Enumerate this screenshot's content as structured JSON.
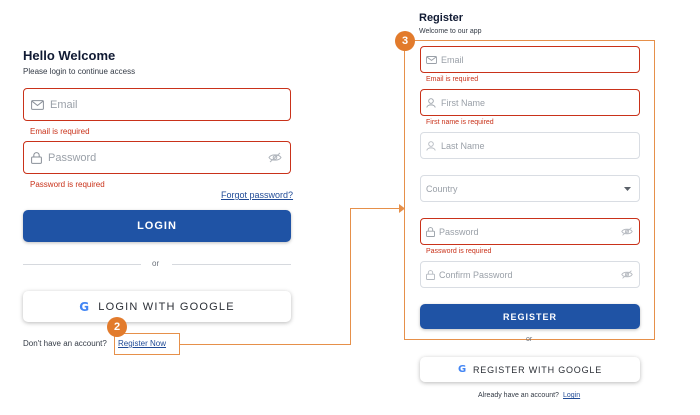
{
  "login": {
    "title": "Hello Welcome",
    "subtitle": "Please login to continue access",
    "email_placeholder": "Email",
    "email_error": "Email is required",
    "password_placeholder": "Password",
    "password_error": "Password is required",
    "forgot_password": "Forgot password?",
    "login_button": "LOGIN",
    "or_text": "or",
    "google_button": "LOGIN WITH GOOGLE",
    "no_account_text": "Don't have an account?",
    "register_link": "Register Now"
  },
  "register": {
    "title": "Register",
    "subtitle": "Welcome to our app",
    "email_placeholder": "Email",
    "email_error": "Email is required",
    "first_name_placeholder": "First Name",
    "first_name_error": "First name is required",
    "last_name_placeholder": "Last Name",
    "country_placeholder": "Country",
    "password_placeholder": "Password",
    "password_error": "Password is required",
    "confirm_password_placeholder": "Confirm Password",
    "register_button": "REGISTER",
    "or_text": "or",
    "google_button": "REGISTER WITH GOOGLE",
    "have_account_text": "Already have an account?",
    "login_link": "Login"
  },
  "annotations": {
    "step_register_link": "2",
    "step_register_form": "3"
  },
  "colors": {
    "error": "#c9321a",
    "primary": "#1f53a5",
    "annotation": "#e27b2c",
    "link": "#1f4a96"
  },
  "icons": [
    "mail-icon",
    "lock-icon",
    "eye-off-icon",
    "user-icon",
    "chevron-down-icon",
    "google-icon"
  ]
}
